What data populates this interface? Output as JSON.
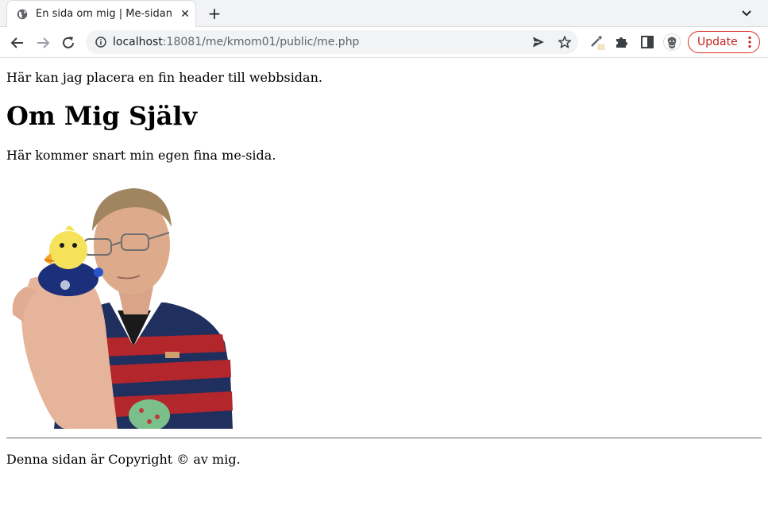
{
  "browser": {
    "tab": {
      "title": "En sida om mig | Me-sidan",
      "close_glyph": "✕",
      "favicon": "globe-icon"
    },
    "new_tab_glyph": "+",
    "url": {
      "host": "localhost",
      "rest": ":18081/me/kmom01/public/me.php"
    },
    "update_label": "Update",
    "accent_color": "#d93025"
  },
  "page": {
    "header_text": "Här kan jag placera en fin header till webbsidan.",
    "title": "Om Mig Själv",
    "intro": "Här kommer snart min egen fina me-sida.",
    "footer": "Denna sidan är Copyright © av mig."
  }
}
